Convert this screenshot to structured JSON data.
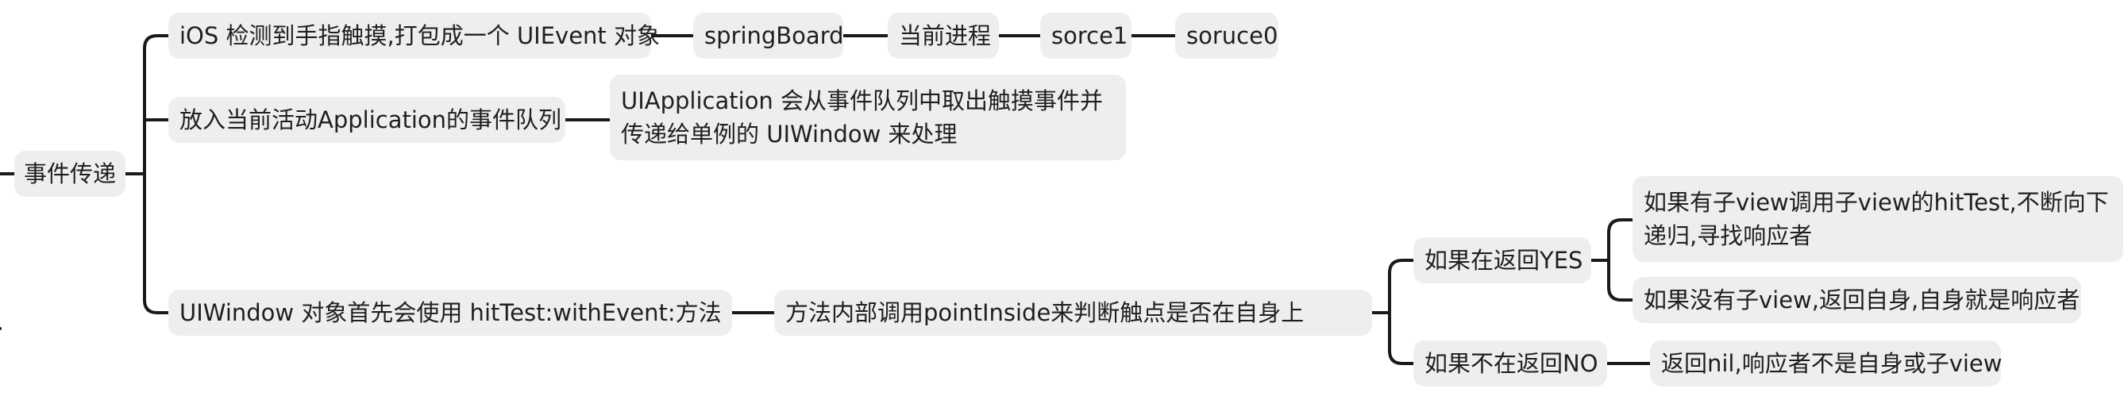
{
  "mindmap": {
    "root": "事件传递",
    "branch1": {
      "label": "iOS 检测到手指触摸,打包成一个 UIEvent 对象",
      "chain": [
        "springBoard",
        "当前进程",
        "sorce1",
        "soruce0"
      ]
    },
    "branch2": {
      "label": "放入当前活动Application的事件队列",
      "child": "UIApplication 会从事件队列中取出触摸事件并传递给单例的 UIWindow 来处理"
    },
    "branch3": {
      "label": "UIWindow 对象首先会使用 hitTest:withEvent:方法",
      "child": "方法内部调用pointInside来判断触点是否在自身上",
      "yes": {
        "label": "如果在返回YES",
        "children": [
          "如果有子view调用子view的hitTest,不断向下递归,寻找响应者",
          "如果没有子view,返回自身,自身就是响应者"
        ]
      },
      "no": {
        "label": "如果不在返回NO",
        "child": "返回nil,响应者不是自身或子view"
      }
    }
  },
  "colors": {
    "node_bg": "#eeeeee",
    "line": "#1a1a1a",
    "text": "#1f1f1f"
  }
}
